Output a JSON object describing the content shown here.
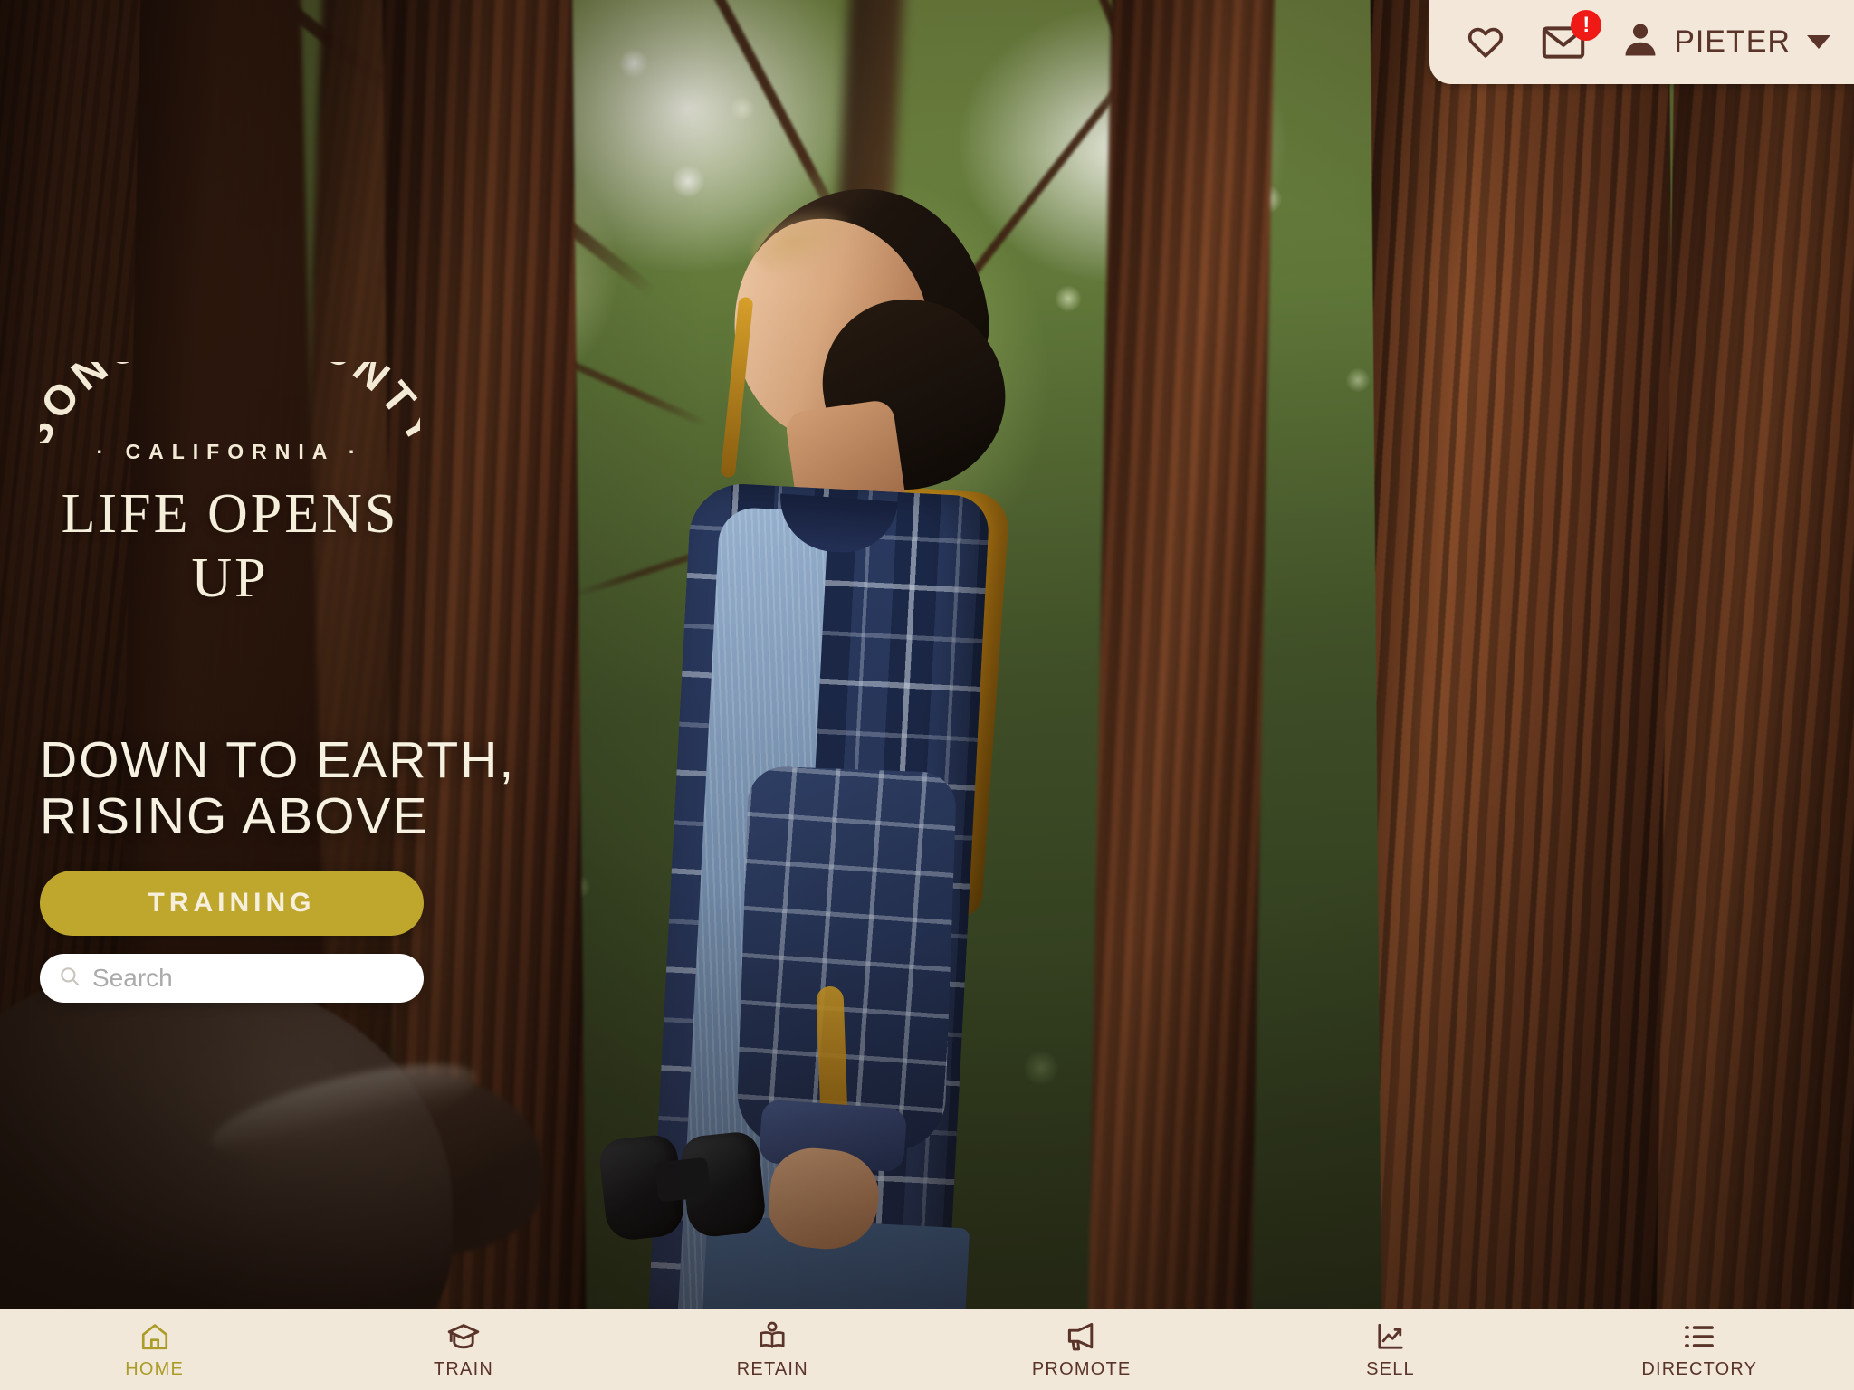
{
  "header": {
    "favorites_icon": "heart-icon",
    "messages_icon": "envelope-icon",
    "notification_badge": "!",
    "avatar_icon": "person-icon",
    "user_name": "PIETER",
    "dropdown_icon": "chevron-down-icon",
    "bar_color": "#f2e7d9",
    "text_color": "#5a3329",
    "badge_color": "#ef1a16"
  },
  "hero": {
    "logo": {
      "arc_text": "SONOMA COUNTY",
      "subtitle": "· CALIFORNIA ·",
      "tagline": "LIFE OPENS UP"
    },
    "headline": "DOWN TO EARTH,\nRISING ABOVE",
    "cta_label": "TRAINING",
    "cta_color": "#bfa72e",
    "search": {
      "icon": "search-icon",
      "placeholder": "Search",
      "value": ""
    },
    "image_description": "Boy with mustard backpack and binoculars looking up in a redwood forest"
  },
  "bottom_nav": {
    "active_color": "#ab9c27",
    "inactive_color": "#5a3329",
    "background": "#f2e8da",
    "items": [
      {
        "label": "HOME",
        "icon": "home-icon",
        "active": true
      },
      {
        "label": "TRAIN",
        "icon": "graduation-cap-icon",
        "active": false
      },
      {
        "label": "RETAIN",
        "icon": "person-reading-book-icon",
        "active": false
      },
      {
        "label": "PROMOTE",
        "icon": "megaphone-icon",
        "active": false
      },
      {
        "label": "SELL",
        "icon": "chart-trend-up-icon",
        "active": false
      },
      {
        "label": "DIRECTORY",
        "icon": "list-bullet-icon",
        "active": false
      }
    ]
  }
}
